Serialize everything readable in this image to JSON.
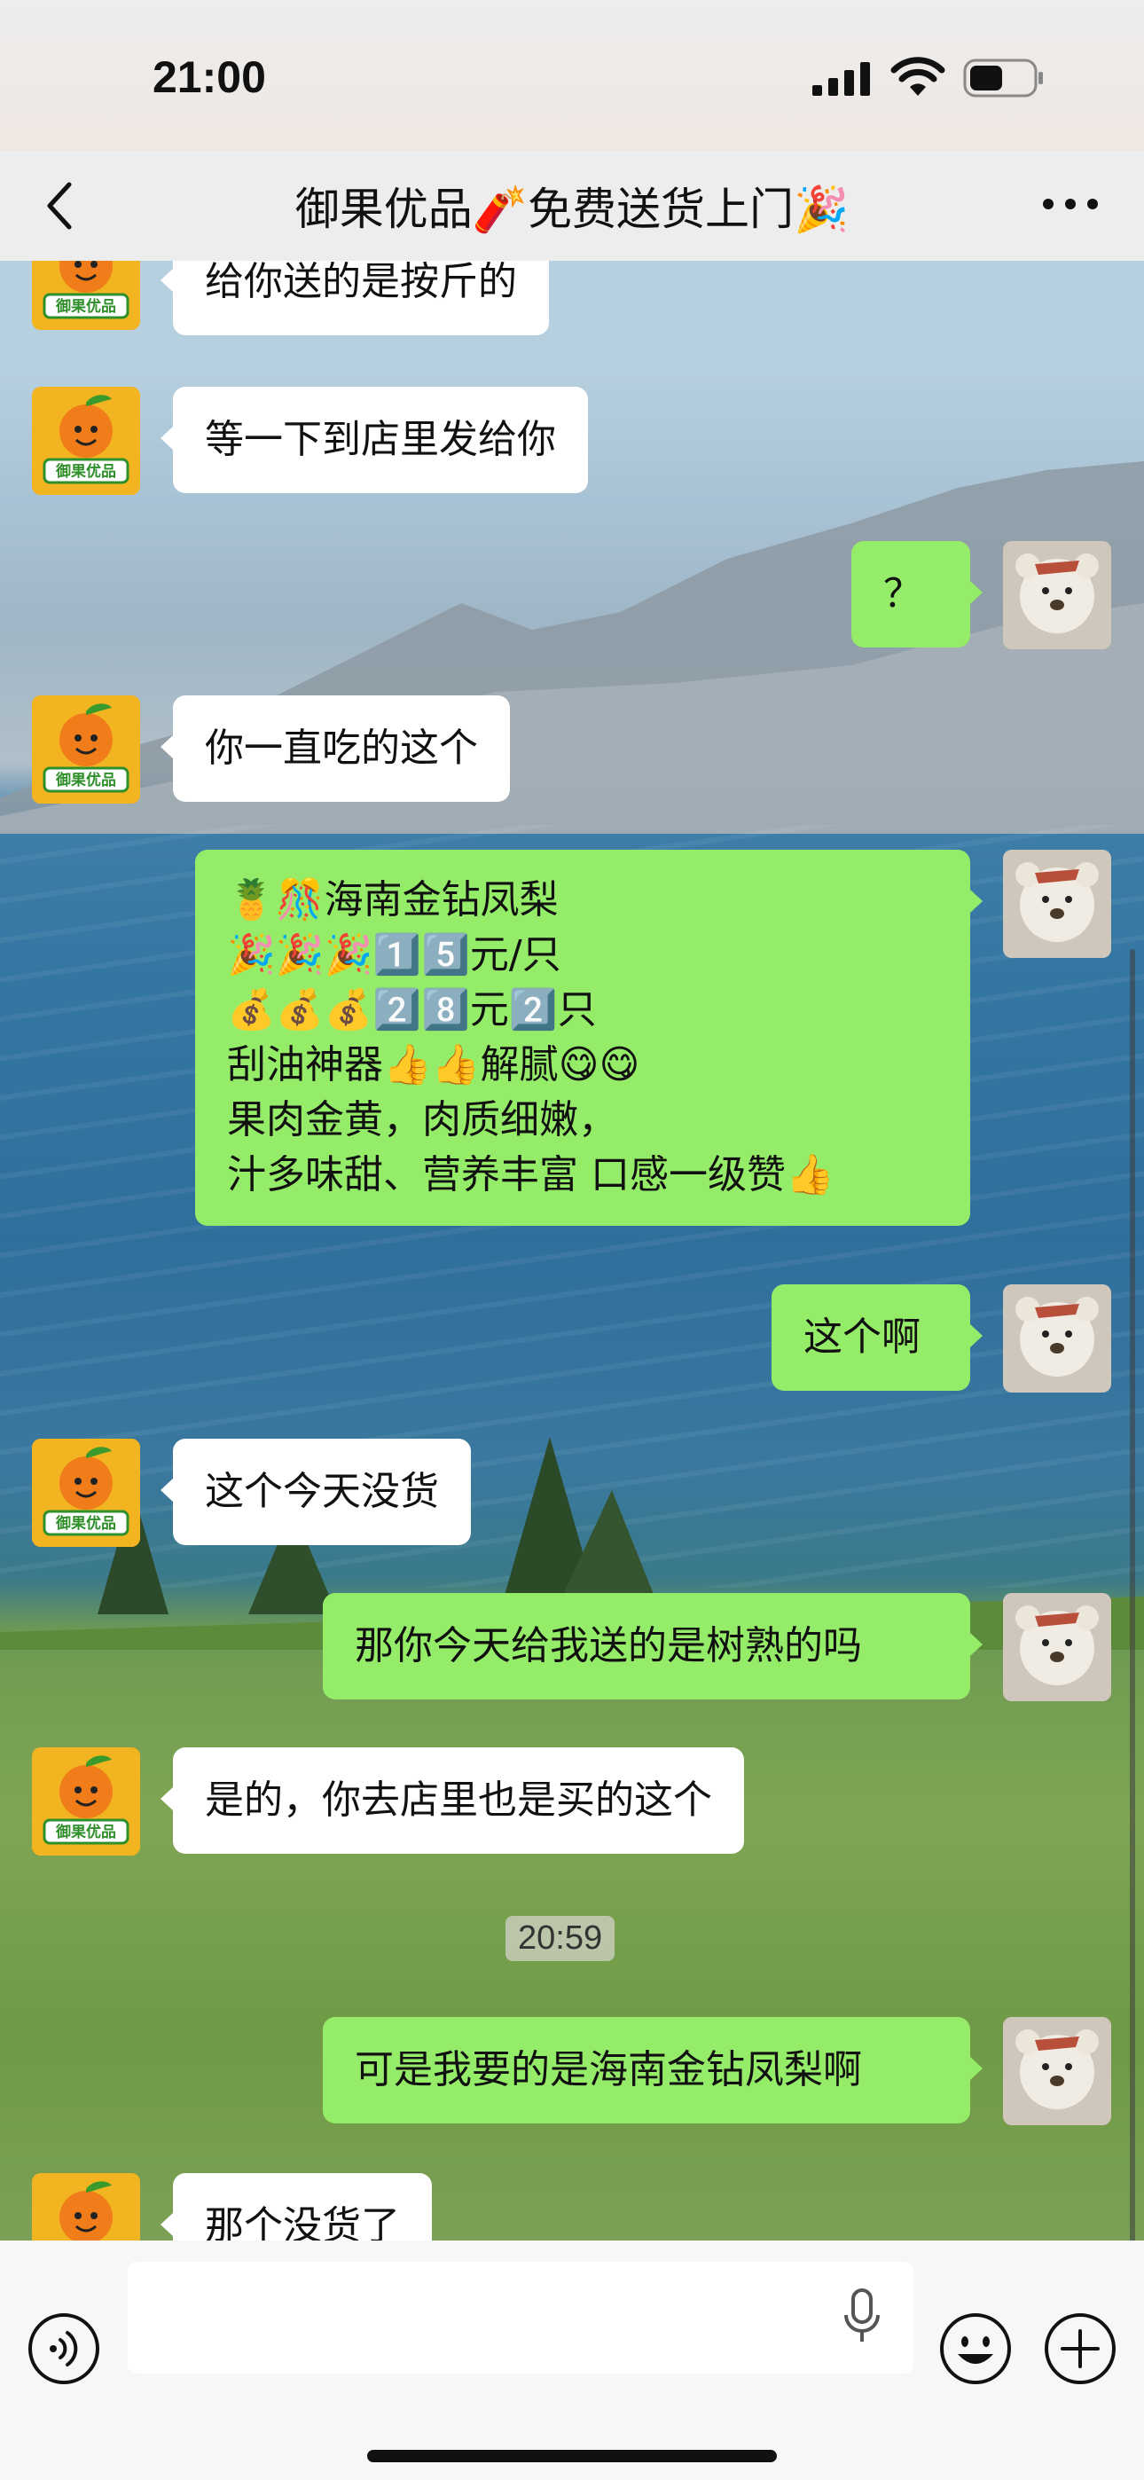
{
  "status_bar": {
    "time": "21:00"
  },
  "header": {
    "title": "御果优品🧨免费送货上门🎉"
  },
  "avatars": {
    "shop_label": "御果优品"
  },
  "messages": [
    {
      "side": "left",
      "text": "给你送的是按斤的"
    },
    {
      "side": "left",
      "text": "等一下到店里发给你"
    },
    {
      "side": "right",
      "text": "？"
    },
    {
      "side": "left",
      "text": "你一直吃的这个"
    },
    {
      "side": "right",
      "text": "🍍🎊海南金钻凤梨\n🎉🎉🎉1️⃣5️⃣元/只\n💰💰💰2️⃣8️⃣元2️⃣只\n刮油神器👍👍解腻😋😋\n果肉金黄，肉质细嫩，\n汁多味甜、营养丰富 口感一级赞👍"
    },
    {
      "side": "right",
      "text": "这个啊"
    },
    {
      "side": "left",
      "text": "这个今天没货"
    },
    {
      "side": "right",
      "text": "那你今天给我送的是树熟的吗"
    },
    {
      "side": "left",
      "text": "是的，你去店里也是买的这个"
    },
    {
      "side": "right",
      "text": "可是我要的是海南金钻凤梨啊"
    },
    {
      "side": "left",
      "text": "那个没货了"
    }
  ],
  "timestamp": "20:59",
  "input": {
    "placeholder": ""
  },
  "colors": {
    "bubble_right": "#95ec69",
    "bubble_left": "#ffffff",
    "header_bg": "#ededed",
    "input_bar_bg": "#f7f7f7"
  },
  "icons": {
    "back": "chevron-left-icon",
    "more": "more-dots-icon",
    "voice": "voice-icon",
    "mic": "mic-icon",
    "emoji": "emoji-icon",
    "plus": "plus-icon"
  }
}
